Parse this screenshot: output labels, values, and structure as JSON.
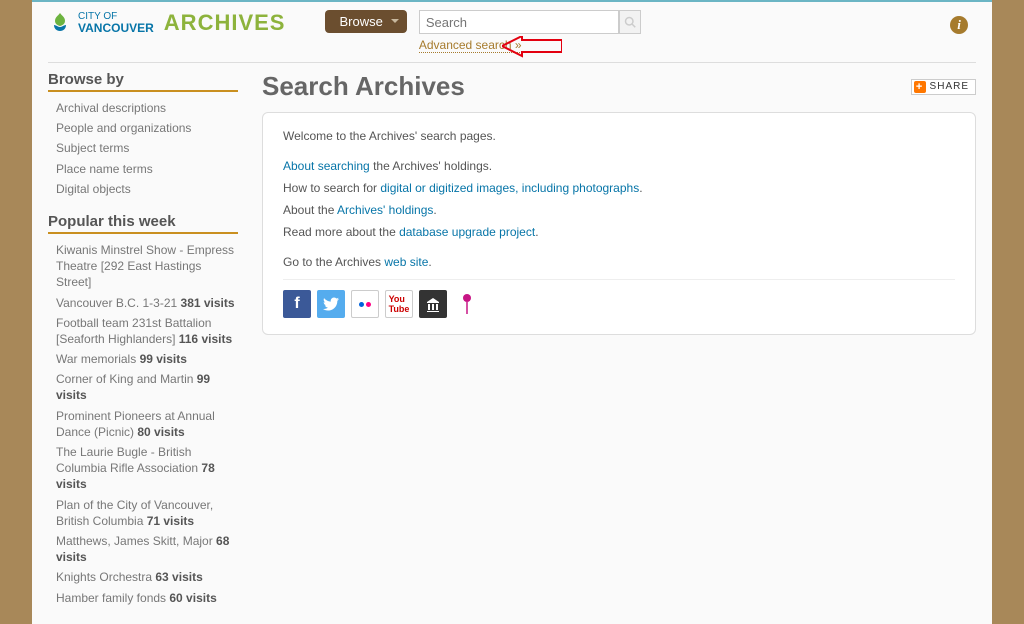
{
  "logo": {
    "cityof": "CITY OF",
    "vancouver": "VANCOUVER",
    "archives": "ARCHIVES"
  },
  "browse_btn": "Browse",
  "search_placeholder": "Search",
  "advanced_search": "Advanced search »",
  "info_glyph": "i",
  "sidebar": {
    "browse_by": "Browse by",
    "items": [
      "Archival descriptions",
      "People and organizations",
      "Subject terms",
      "Place name terms",
      "Digital objects"
    ],
    "popular": "Popular this week",
    "popular_items": [
      {
        "t": "Kiwanis Minstrel Show - Empress Theatre [292 East Hastings Street]",
        "v": null
      },
      {
        "t": "Vancouver B.C. 1-3-21",
        "v": "381 visits"
      },
      {
        "t": "Football team 231st Battalion [Seaforth Highlanders]",
        "v": "116 visits"
      },
      {
        "t": "War memorials",
        "v": "99 visits"
      },
      {
        "t": "Corner of King and Martin",
        "v": "99 visits"
      },
      {
        "t": "Prominent Pioneers at Annual Dance (Picnic)",
        "v": "80 visits"
      },
      {
        "t": "The Laurie Bugle - British Columbia Rifle Association",
        "v": "78 visits"
      },
      {
        "t": "Plan of the City of Vancouver, British Columbia",
        "v": "71 visits"
      },
      {
        "t": "Matthews, James Skitt, Major",
        "v": "68 visits"
      },
      {
        "t": "Knights Orchestra",
        "v": "63 visits"
      },
      {
        "t": "Hamber family fonds",
        "v": "60 visits"
      }
    ]
  },
  "main": {
    "title": "Search Archives",
    "share": "SHARE",
    "welcome": "Welcome to the Archives' search pages.",
    "p1_a": "About searching",
    "p1_b": " the Archives' holdings.",
    "p2_a": "How to search for ",
    "p2_b": "digital or digitized images, including photographs",
    "p2_c": ".",
    "p3_a": "About the ",
    "p3_b": "Archives' holdings",
    "p3_c": ".",
    "p4_a": "Read more about the ",
    "p4_b": "database upgrade project",
    "p4_c": ".",
    "p5_a": "Go to the Archives ",
    "p5_b": "web site",
    "p5_c": "."
  }
}
